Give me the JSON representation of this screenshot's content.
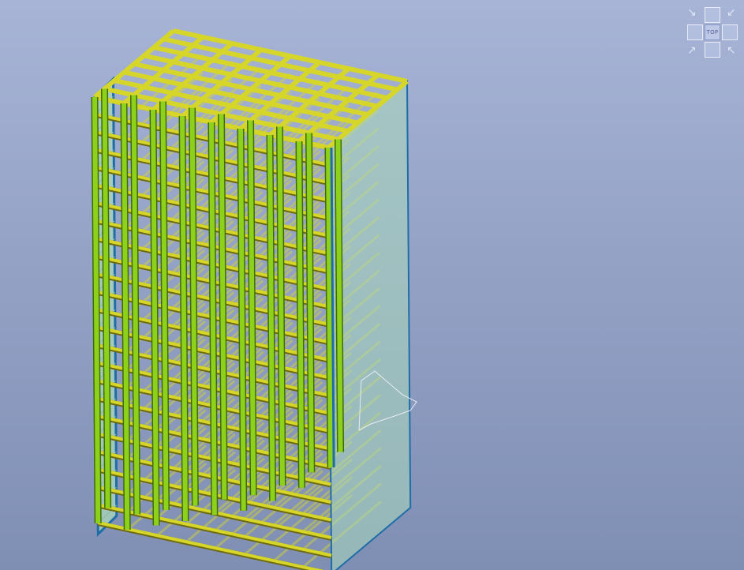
{
  "colors": {
    "background_top": "#a7b4d6",
    "background_bottom": "#7f8fb3",
    "column": "#8ed11a",
    "column_edge": "#3f6b0c",
    "beam": "#d6d62a",
    "beam_edge": "#6e6a10",
    "wall_panel": "#a9d8bb",
    "wall_edge": "#1f6da7",
    "wireframe": "#e8ecf4"
  },
  "model": {
    "type": "multi-storey structural frame",
    "storeys": 24,
    "view": "isometric"
  },
  "view_cube": {
    "center_label": "TOP",
    "arrows": {
      "top_left": "↘",
      "top_right": "↙",
      "bottom_left": "↗",
      "bottom_right": "↖"
    }
  }
}
